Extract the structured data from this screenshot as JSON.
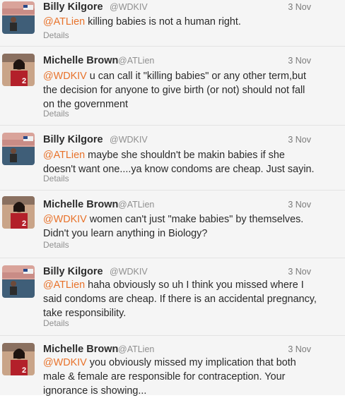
{
  "tweets": [
    {
      "name": "Billy Kilgore",
      "handle": "@WDKIV",
      "date": "3 Nov",
      "mention": "@ATLien",
      "text": " killing babies is not a human right.",
      "details": "Details"
    },
    {
      "name": "Michelle Brown",
      "handle": "@ATLien",
      "date": "3 Nov",
      "mention": "@WDKIV",
      "text": " u can call it \"killing babies\" or any other term,but the decision for anyone to give birth (or not) should not fall on the government",
      "details": "Details"
    },
    {
      "name": "Billy Kilgore",
      "handle": "@WDKIV",
      "date": "3 Nov",
      "mention": "@ATLien",
      "text": " maybe she shouldn't be makin babies if she doesn't want one....ya know condoms are cheap. Just sayin.",
      "details": "Details"
    },
    {
      "name": "Michelle Brown",
      "handle": "@ATLien",
      "date": "3 Nov",
      "mention": "@WDKIV",
      "text": " women can't just \"make babies\" by themselves. Didn't you learn anything in Biology?",
      "details": "Details"
    },
    {
      "name": "Billy Kilgore",
      "handle": "@WDKIV",
      "date": "3 Nov",
      "mention": "@ATLien",
      "text": " haha obviously so uh I think you missed where I said condoms are cheap. If there is an accidental pregnancy, take responsibility.",
      "details": "Details"
    },
    {
      "name": "Michelle Brown",
      "handle": "@ATLien",
      "date": "3 Nov",
      "mention": "@WDKIV",
      "text": " you obviously missed my implication that both male & female are responsible for contraception. Your ignorance is showing...",
      "details": ""
    }
  ],
  "colors": {
    "mention": "#e8722a",
    "row_background": "#f5f5f5"
  }
}
